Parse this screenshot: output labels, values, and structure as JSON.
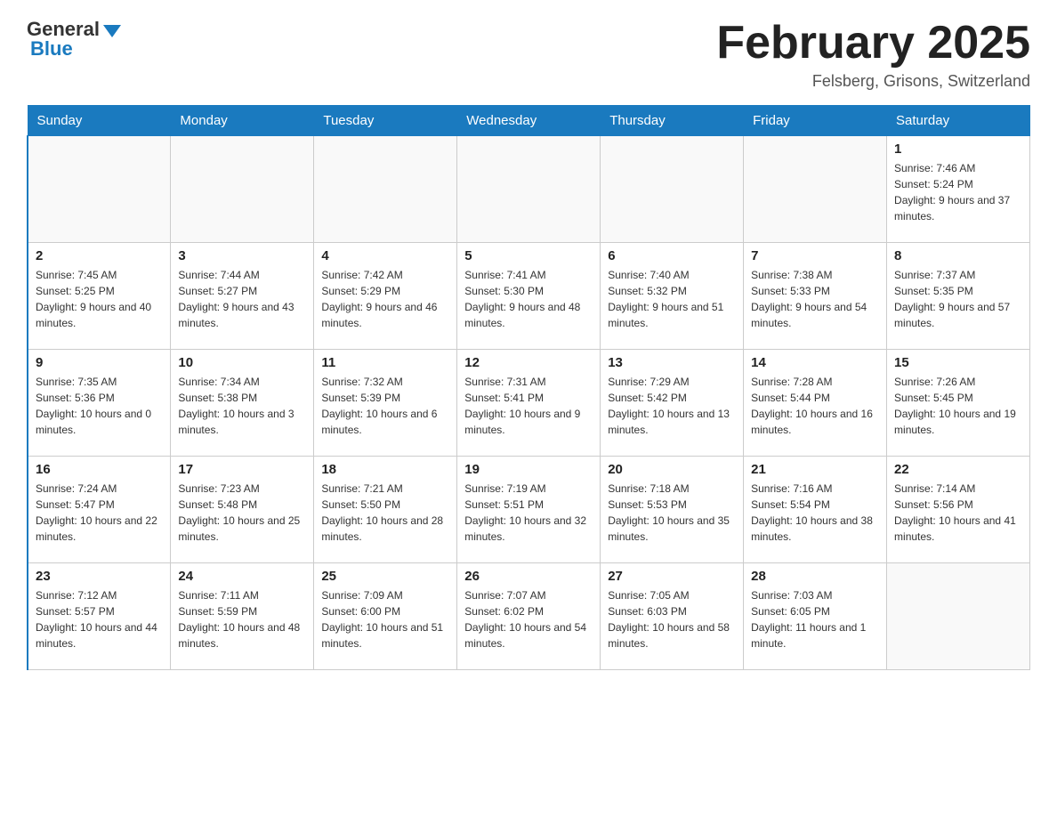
{
  "logo": {
    "general": "General",
    "blue": "Blue"
  },
  "title": "February 2025",
  "subtitle": "Felsberg, Grisons, Switzerland",
  "days_of_week": [
    "Sunday",
    "Monday",
    "Tuesday",
    "Wednesday",
    "Thursday",
    "Friday",
    "Saturday"
  ],
  "weeks": [
    [
      {
        "day": "",
        "info": ""
      },
      {
        "day": "",
        "info": ""
      },
      {
        "day": "",
        "info": ""
      },
      {
        "day": "",
        "info": ""
      },
      {
        "day": "",
        "info": ""
      },
      {
        "day": "",
        "info": ""
      },
      {
        "day": "1",
        "info": "Sunrise: 7:46 AM\nSunset: 5:24 PM\nDaylight: 9 hours and 37 minutes."
      }
    ],
    [
      {
        "day": "2",
        "info": "Sunrise: 7:45 AM\nSunset: 5:25 PM\nDaylight: 9 hours and 40 minutes."
      },
      {
        "day": "3",
        "info": "Sunrise: 7:44 AM\nSunset: 5:27 PM\nDaylight: 9 hours and 43 minutes."
      },
      {
        "day": "4",
        "info": "Sunrise: 7:42 AM\nSunset: 5:29 PM\nDaylight: 9 hours and 46 minutes."
      },
      {
        "day": "5",
        "info": "Sunrise: 7:41 AM\nSunset: 5:30 PM\nDaylight: 9 hours and 48 minutes."
      },
      {
        "day": "6",
        "info": "Sunrise: 7:40 AM\nSunset: 5:32 PM\nDaylight: 9 hours and 51 minutes."
      },
      {
        "day": "7",
        "info": "Sunrise: 7:38 AM\nSunset: 5:33 PM\nDaylight: 9 hours and 54 minutes."
      },
      {
        "day": "8",
        "info": "Sunrise: 7:37 AM\nSunset: 5:35 PM\nDaylight: 9 hours and 57 minutes."
      }
    ],
    [
      {
        "day": "9",
        "info": "Sunrise: 7:35 AM\nSunset: 5:36 PM\nDaylight: 10 hours and 0 minutes."
      },
      {
        "day": "10",
        "info": "Sunrise: 7:34 AM\nSunset: 5:38 PM\nDaylight: 10 hours and 3 minutes."
      },
      {
        "day": "11",
        "info": "Sunrise: 7:32 AM\nSunset: 5:39 PM\nDaylight: 10 hours and 6 minutes."
      },
      {
        "day": "12",
        "info": "Sunrise: 7:31 AM\nSunset: 5:41 PM\nDaylight: 10 hours and 9 minutes."
      },
      {
        "day": "13",
        "info": "Sunrise: 7:29 AM\nSunset: 5:42 PM\nDaylight: 10 hours and 13 minutes."
      },
      {
        "day": "14",
        "info": "Sunrise: 7:28 AM\nSunset: 5:44 PM\nDaylight: 10 hours and 16 minutes."
      },
      {
        "day": "15",
        "info": "Sunrise: 7:26 AM\nSunset: 5:45 PM\nDaylight: 10 hours and 19 minutes."
      }
    ],
    [
      {
        "day": "16",
        "info": "Sunrise: 7:24 AM\nSunset: 5:47 PM\nDaylight: 10 hours and 22 minutes."
      },
      {
        "day": "17",
        "info": "Sunrise: 7:23 AM\nSunset: 5:48 PM\nDaylight: 10 hours and 25 minutes."
      },
      {
        "day": "18",
        "info": "Sunrise: 7:21 AM\nSunset: 5:50 PM\nDaylight: 10 hours and 28 minutes."
      },
      {
        "day": "19",
        "info": "Sunrise: 7:19 AM\nSunset: 5:51 PM\nDaylight: 10 hours and 32 minutes."
      },
      {
        "day": "20",
        "info": "Sunrise: 7:18 AM\nSunset: 5:53 PM\nDaylight: 10 hours and 35 minutes."
      },
      {
        "day": "21",
        "info": "Sunrise: 7:16 AM\nSunset: 5:54 PM\nDaylight: 10 hours and 38 minutes."
      },
      {
        "day": "22",
        "info": "Sunrise: 7:14 AM\nSunset: 5:56 PM\nDaylight: 10 hours and 41 minutes."
      }
    ],
    [
      {
        "day": "23",
        "info": "Sunrise: 7:12 AM\nSunset: 5:57 PM\nDaylight: 10 hours and 44 minutes."
      },
      {
        "day": "24",
        "info": "Sunrise: 7:11 AM\nSunset: 5:59 PM\nDaylight: 10 hours and 48 minutes."
      },
      {
        "day": "25",
        "info": "Sunrise: 7:09 AM\nSunset: 6:00 PM\nDaylight: 10 hours and 51 minutes."
      },
      {
        "day": "26",
        "info": "Sunrise: 7:07 AM\nSunset: 6:02 PM\nDaylight: 10 hours and 54 minutes."
      },
      {
        "day": "27",
        "info": "Sunrise: 7:05 AM\nSunset: 6:03 PM\nDaylight: 10 hours and 58 minutes."
      },
      {
        "day": "28",
        "info": "Sunrise: 7:03 AM\nSunset: 6:05 PM\nDaylight: 11 hours and 1 minute."
      },
      {
        "day": "",
        "info": ""
      }
    ]
  ]
}
